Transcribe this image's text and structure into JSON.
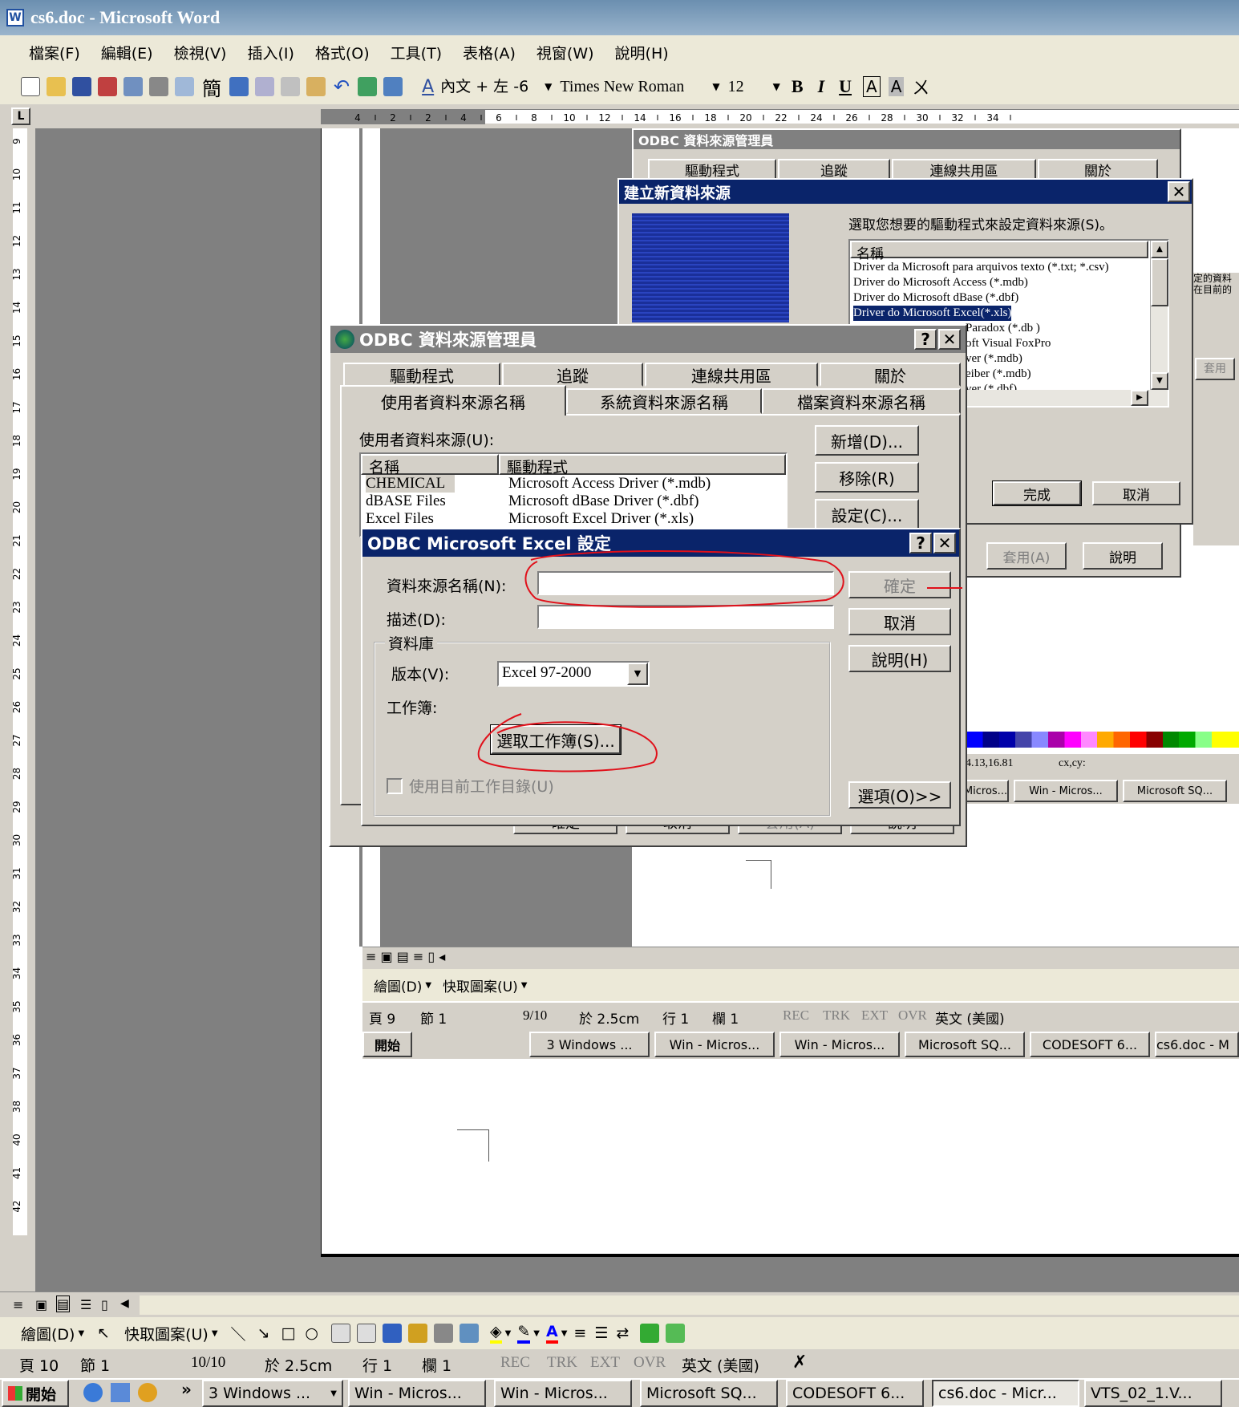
{
  "window": {
    "title": "cs6.doc - Microsoft Word"
  },
  "menu": [
    "檔案(F)",
    "編輯(E)",
    "檢視(V)",
    "插入(I)",
    "格式(O)",
    "工具(T)",
    "表格(A)",
    "視窗(W)",
    "說明(H)"
  ],
  "format_bar": {
    "style": "內文 + 左 -6",
    "font": "Times New Roman",
    "size": "12",
    "bold": "B",
    "italic": "I",
    "underline": "U"
  },
  "ruler": {
    "corner": "L",
    "ticks": [
      "4",
      "2",
      "2",
      "4",
      "6",
      "8",
      "10",
      "12",
      "14",
      "16",
      "18",
      "20",
      "22",
      "24",
      "26",
      "28",
      "30",
      "32",
      "34"
    ]
  },
  "vruler": [
    "9",
    "10",
    "11",
    "12",
    "13",
    "14",
    "15",
    "16",
    "17",
    "18",
    "19",
    "20",
    "21",
    "22",
    "23",
    "24",
    "25",
    "26",
    "27",
    "28",
    "29",
    "30",
    "31",
    "32",
    "33",
    "34",
    "35",
    "36",
    "37",
    "38",
    "40",
    "41",
    "42"
  ],
  "bg_odbc": {
    "title": "ODBC 資料來源管理員",
    "tabs": [
      "驅動程式",
      "追蹤",
      "連線共用區",
      "關於"
    ]
  },
  "new_ds": {
    "title": "建立新資料來源",
    "prompt": "選取您想要的驅動程式來設定資料來源(S)。",
    "col_name": "名稱",
    "drivers": [
      "Driver da Microsoft para arquivos texto (*.txt; *.csv)",
      "Driver do Microsoft Access (*.mdb)",
      "Driver do Microsoft dBase (*.dbf)",
      "Driver do Microsoft Excel(*.xls)",
      "Paradox (*.db )",
      "oft Visual FoxPro",
      "ver (*.mdb)",
      "eiber (*.mdb)",
      "ver (*.dbf)"
    ],
    "finish": "完成",
    "cancel": "取消",
    "side1": "定的資料",
    "side2": "在目前的",
    "apply": "套用",
    "back_partial": "B)"
  },
  "odbc_admin": {
    "title": "ODBC 資料來源管理員",
    "tabs_back": [
      "驅動程式",
      "追蹤",
      "連線共用區",
      "關於"
    ],
    "tabs_front": [
      "使用者資料來源名稱",
      "系統資料來源名稱",
      "檔案資料來源名稱"
    ],
    "section_label": "使用者資料來源(U):",
    "col_name": "名稱",
    "col_driver": "驅動程式",
    "rows": [
      {
        "name": "CHEMICAL",
        "driver": "Microsoft Access Driver (*.mdb)"
      },
      {
        "name": "dBASE Files",
        "driver": "Microsoft dBase Driver (*.dbf)"
      },
      {
        "name": "Excel Files",
        "driver": "Microsoft Excel Driver (*.xls)"
      }
    ],
    "btn_add": "新增(D)...",
    "btn_remove": "移除(R)",
    "btn_config": "設定(C)...",
    "btn_apply": "套用(A)",
    "btn_help": "說明",
    "bottom_buttons": [
      "確定",
      "取消",
      "套用(A)",
      "說明"
    ]
  },
  "excel_setup": {
    "title": "ODBC Microsoft Excel 設定",
    "dsn_label": "資料來源名稱(N):",
    "dsn_value": "",
    "desc_label": "描述(D):",
    "desc_value": "",
    "group_label": "資料庫",
    "version_label": "版本(V):",
    "version_value": "Excel 97-2000",
    "workbook_label": "工作簿:",
    "select_workbook": "選取工作簿(S)...",
    "use_current_dir": "使用目前工作目錄(U)",
    "btn_ok": "確定",
    "btn_cancel": "取消",
    "btn_help": "說明(H)",
    "btn_options": "選項(O)>>"
  },
  "mini_screenshot": {
    "coords": "4.13,16.81",
    "cxcy": "cx,cy:",
    "tasks": [
      "Micros...",
      "Win - Micros...",
      "Microsoft SQ..."
    ]
  },
  "inner_drawbar": {
    "draw": "繪圖(D)",
    "autoshape": "快取圖案(U)"
  },
  "inner_status": [
    "頁 9",
    "節 1",
    "9/10",
    "於 2.5cm",
    "行 1",
    "欄 1",
    "REC",
    "TRK",
    "EXT",
    "OVR",
    "英文 (美國)"
  ],
  "inner_taskbar": [
    "開始",
    "3 Windows ...",
    "Win - Micros...",
    "Win - Micros...",
    "Microsoft SQ...",
    "CODESOFT 6...",
    "cs6.doc - M"
  ],
  "drawbar": {
    "draw": "繪圖(D)",
    "autoshape": "快取圖案(U)"
  },
  "status": {
    "page": "頁 10",
    "section": "節 1",
    "pages": "10/10",
    "at": "於 2.5cm",
    "line": "行 1",
    "col": "欄 1",
    "rec": "REC",
    "trk": "TRK",
    "ext": "EXT",
    "ovr": "OVR",
    "lang": "英文 (美國)"
  },
  "taskbar": {
    "start": "開始",
    "items": [
      "3 Windows ...",
      "Win - Micros...",
      "Win - Micros...",
      "Microsoft SQ...",
      "CODESOFT 6...",
      "cs6.doc - Micr...",
      "VTS_02_1.V..."
    ]
  },
  "colors": {
    "title_active": "#0a246a",
    "title_inactive": "#808080",
    "face": "#d4d0c8",
    "annotation": "#e0101a",
    "selection": "#0a246a"
  }
}
